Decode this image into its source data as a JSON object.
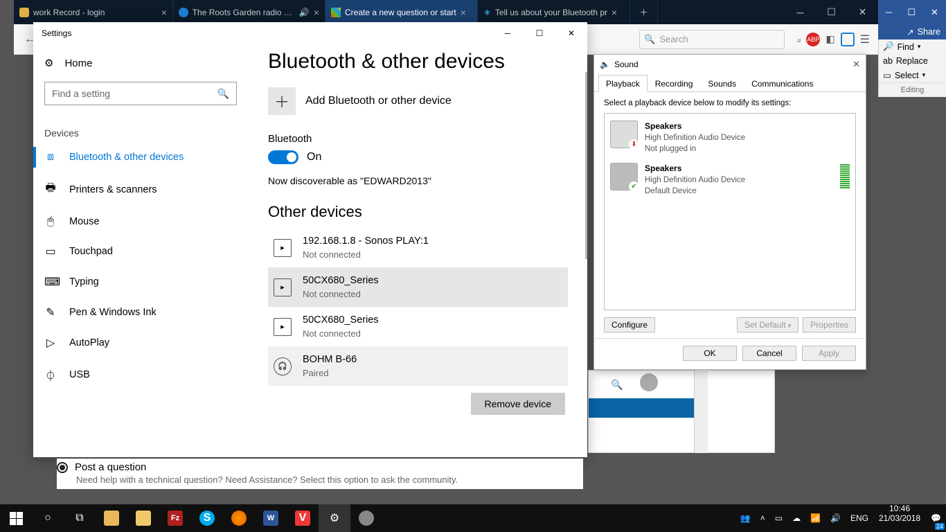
{
  "browser": {
    "tabs": [
      {
        "title": "work Record - login",
        "icon_color": "#e0b040"
      },
      {
        "title": "The Roots Garden radio sho",
        "icon_color": "#1a80d0",
        "audio": true
      },
      {
        "title": "Create a new question or start",
        "icon_color": "#00a4ef",
        "active": true
      },
      {
        "title": "Tell us about your Bluetooth pr",
        "icon_color": "#0078d7"
      }
    ],
    "search_placeholder": "Search"
  },
  "ribbon": {
    "share": "Share",
    "find": "Find",
    "replace": "Replace",
    "select": "Select",
    "group": "Editing"
  },
  "settings": {
    "window_title": "Settings",
    "home": "Home",
    "find_placeholder": "Find a setting",
    "section": "Devices",
    "nav": [
      "Bluetooth & other devices",
      "Printers & scanners",
      "Mouse",
      "Touchpad",
      "Typing",
      "Pen & Windows Ink",
      "AutoPlay",
      "USB"
    ],
    "page_title": "Bluetooth & other devices",
    "add_label": "Add Bluetooth or other device",
    "bt_heading": "Bluetooth",
    "bt_state": "On",
    "discoverable": "Now discoverable as \"EDWARD2013\"",
    "other_heading": "Other devices",
    "devices": [
      {
        "name": "192.168.1.8 - Sonos PLAY:1",
        "status": "Not connected"
      },
      {
        "name": "50CX680_Series",
        "status": "Not connected",
        "selected": true
      },
      {
        "name": "50CX680_Series",
        "status": "Not connected"
      },
      {
        "name": "BOHM B-66",
        "status": "Paired",
        "paired": true
      }
    ],
    "remove": "Remove device"
  },
  "question": {
    "title": "Post a question",
    "sub": "Need help with a technical question? Need Assistance? Select this option to ask the community."
  },
  "sound": {
    "title": "Sound",
    "tabs": [
      "Playback",
      "Recording",
      "Sounds",
      "Communications"
    ],
    "instruction": "Select a playback device below to modify its settings:",
    "devices": [
      {
        "name": "Speakers",
        "driver": "High Definition Audio Device",
        "state": "Not plugged in",
        "badge": "⬇",
        "badge_color": "#d03020"
      },
      {
        "name": "Speakers",
        "driver": "High Definition Audio Device",
        "state": "Default Device",
        "badge": "✔",
        "badge_color": "#2a9a2a",
        "default": true
      }
    ],
    "configure": "Configure",
    "set_default": "Set Default",
    "properties": "Properties",
    "ok": "OK",
    "cancel": "Cancel",
    "apply": "Apply"
  },
  "tray": {
    "lang": "ENG",
    "time": "10:46",
    "date": "21/03/2018",
    "notif": "24"
  }
}
